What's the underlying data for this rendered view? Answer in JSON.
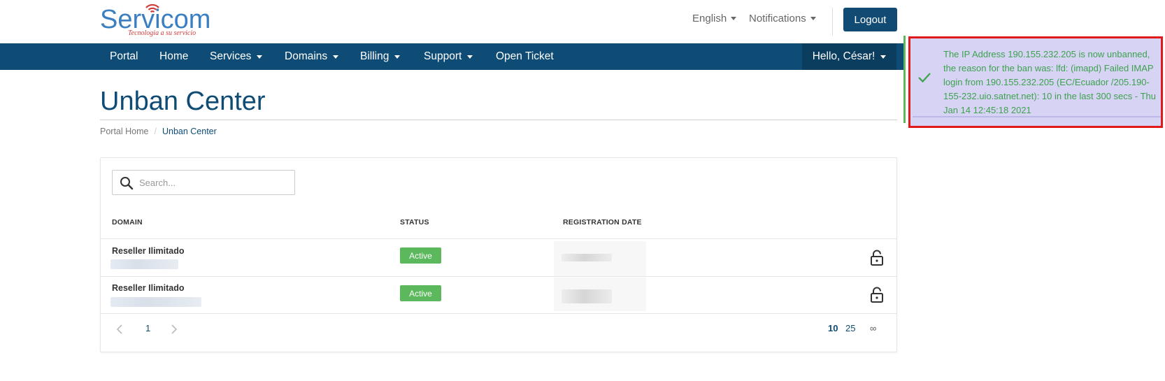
{
  "header": {
    "logo": {
      "brand": "Servicom",
      "tagline": "Tecnologia a su servicio"
    },
    "language_label": "English",
    "notifications_label": "Notifications",
    "logout_label": "Logout"
  },
  "nav": {
    "items": [
      {
        "label": "Portal"
      },
      {
        "label": "Home"
      },
      {
        "label": "Services"
      },
      {
        "label": "Domains"
      },
      {
        "label": "Billing"
      },
      {
        "label": "Support"
      },
      {
        "label": "Open Ticket"
      }
    ],
    "user_label": "Hello, César!"
  },
  "page": {
    "title": "Unban Center",
    "breadcrumb": [
      "Portal Home",
      "Unban Center"
    ]
  },
  "table": {
    "search_placeholder": "Search...",
    "columns": [
      "DOMAIN",
      "STATUS",
      "REGISTRATION DATE"
    ],
    "rows": [
      {
        "product": "Reseller Ilimitado",
        "status": "Active"
      },
      {
        "product": "Reseller Ilimitado",
        "status": "Active"
      }
    ],
    "pagination": {
      "current_page": "1",
      "per_page_options": [
        "10",
        "25",
        "∞"
      ]
    }
  },
  "toast": {
    "message": "The IP Address 190.155.232.205 is now unbanned, the reason for the ban was: lfd: (imapd) Failed IMAP login from 190.155.232.205 (EC/Ecuador /205.190-155-232.uio.satnet.net): 10 in the last 300 secs - Thu Jan 14 12:45:18 2021"
  },
  "colors": {
    "primary": "#0f4c75",
    "success": "#5cb85c",
    "toast_bg": "#d6d3f5",
    "toast_border": "#e01a1a"
  }
}
